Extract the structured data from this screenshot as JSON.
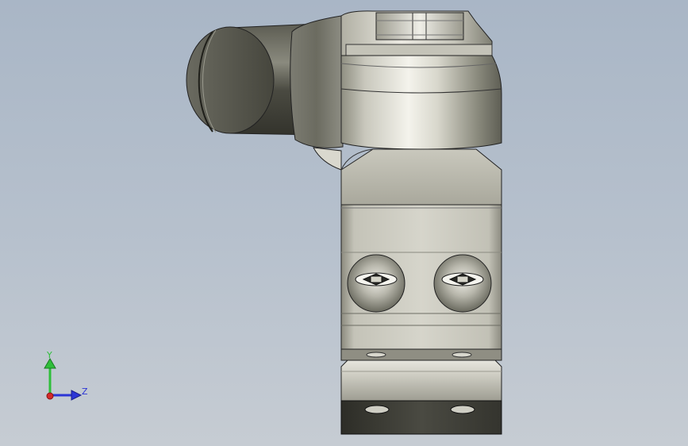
{
  "scene": {
    "background_top": "#a9b6c6",
    "background_bottom": "#c6ccd3",
    "subject": "cad-part-angled-connector",
    "part_colors": {
      "metal_light": "#e4e3dc",
      "metal_mid": "#a9a99b",
      "metal_dark": "#55554b",
      "cable_dark": "#3e3e34"
    }
  },
  "triad": {
    "y_label": "Y",
    "z_label": "Z",
    "y_color": "#2fbf3a",
    "z_color": "#2b35d6",
    "x_color": "#d42a2a"
  }
}
